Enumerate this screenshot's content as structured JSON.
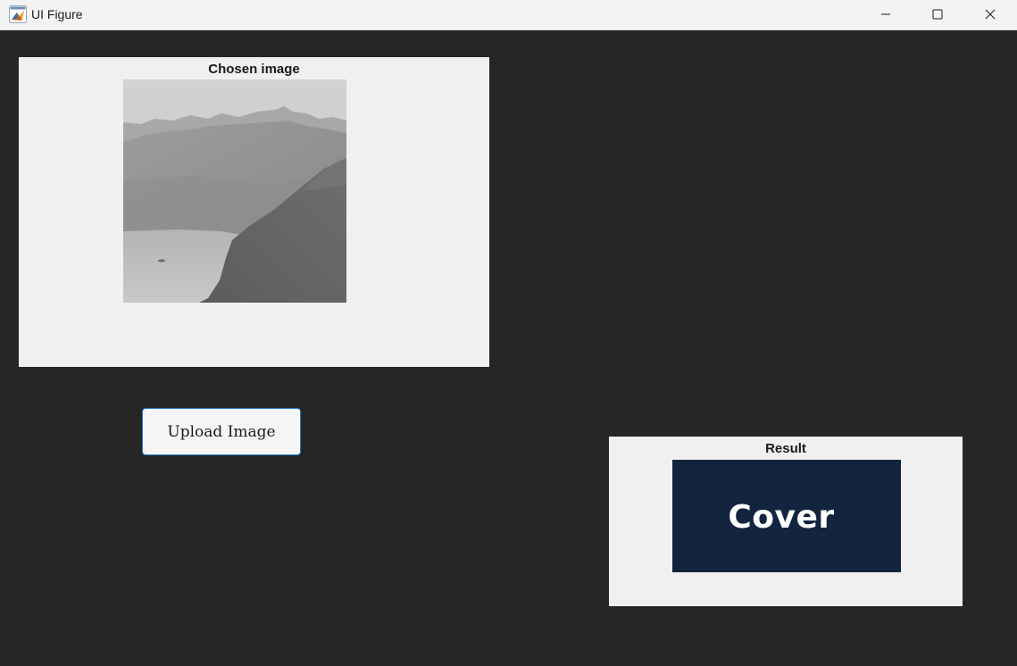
{
  "window": {
    "title": "UI Figure",
    "app_icon": "matlab-icon",
    "controls": {
      "minimize": "minimize-icon",
      "maximize": "maximize-icon",
      "close": "close-icon"
    }
  },
  "chosen_panel": {
    "title": "Chosen image",
    "image": "grayscale-coastal-cliffs-photo"
  },
  "upload": {
    "label": "Upload Image"
  },
  "result_panel": {
    "title": "Result",
    "cover_text": "Cover",
    "cover_color": "#12243e"
  },
  "colors": {
    "background": "#262626",
    "panel": "#f0f0f0",
    "button_border": "#1e78c8"
  }
}
